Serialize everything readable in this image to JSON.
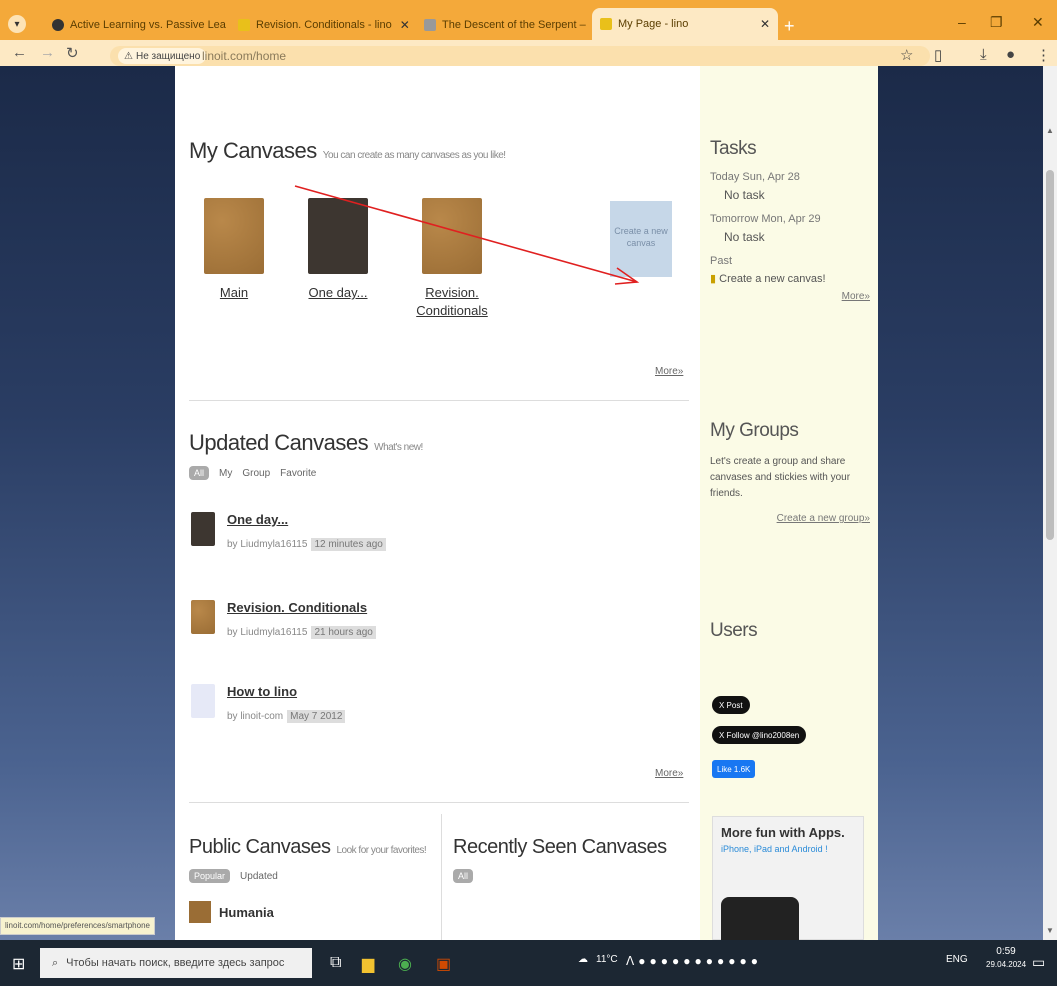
{
  "browser": {
    "tabs": [
      {
        "title": "Active Learning vs. Passive Lea",
        "icon": "circle-icon",
        "color": "#333333"
      },
      {
        "title": "Revision. Conditionals - lino",
        "icon": "lino-icon",
        "color": "#e9c01a"
      },
      {
        "title": "The Descent of the Serpent –",
        "icon": "doc-icon",
        "color": "#999999"
      },
      {
        "title": "My Page - lino",
        "icon": "lino-icon",
        "color": "#e9c01a"
      }
    ],
    "security_label": "Не защищено",
    "url": "linoit.com/home"
  },
  "my_canvases": {
    "title": "My Canvases",
    "subtitle": "You can create as many canvases as you like!",
    "items": [
      {
        "label": "Main"
      },
      {
        "label": "One day..."
      },
      {
        "label": "Revision. Conditionals"
      }
    ],
    "new_canvas_label": "Create a new canvas",
    "more": "More»"
  },
  "updated": {
    "title": "Updated Canvases",
    "subtitle": "What's new!",
    "filters": [
      "All",
      "My",
      "Group",
      "Favorite"
    ],
    "items": [
      {
        "title": "One day...",
        "by": "by Liudmyla16115",
        "when": "12 minutes ago"
      },
      {
        "title": "Revision. Conditionals",
        "by": "by Liudmyla16115",
        "when": "21 hours ago"
      },
      {
        "title": "How to lino",
        "by": "by linoit-com",
        "when": "May 7 2012"
      }
    ],
    "more": "More»"
  },
  "public": {
    "title": "Public Canvases",
    "subtitle": "Look for your favorites!",
    "filters": [
      "Popular",
      "Updated"
    ],
    "first_item": "Humania"
  },
  "recent": {
    "title": "Recently Seen Canvases",
    "filter": "All"
  },
  "sidebar": {
    "tasks_title": "Tasks",
    "today": "Today Sun, Apr 28",
    "today_task": "No task",
    "tomorrow": "Tomorrow Mon, Apr 29",
    "tomorrow_task": "No task",
    "past": "Past",
    "past_task": "Create a new canvas!",
    "tasks_more": "More»",
    "groups_title": "My Groups",
    "groups_text": "Let's create a group and share canvases and stickies with your friends.",
    "groups_link": "Create a new group»",
    "users_title": "Users",
    "x_post": "X Post",
    "x_follow": "X Follow @lino2008en",
    "fb_like": "Like 1.6K",
    "apps_title": "More fun with Apps.",
    "apps_sub": "iPhone, iPad and Android !"
  },
  "status_url": "linoit.com/home/preferences/smartphone",
  "taskbar": {
    "search_placeholder": "Чтобы начать поиск, введите здесь запрос",
    "weather": "11°C",
    "lang": "ENG",
    "time": "0:59",
    "date": "29.04.2024"
  }
}
